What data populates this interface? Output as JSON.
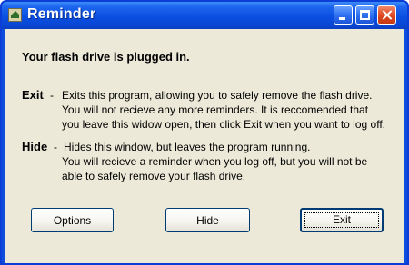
{
  "window": {
    "title": "Reminder",
    "icon": "app-icon"
  },
  "titlebar_buttons": {
    "minimize": "minimize-icon",
    "maximize": "maximize-icon",
    "close": "close-icon"
  },
  "content": {
    "headline": "Your flash drive is plugged in.",
    "exit_term": "Exit",
    "exit_sep": "-",
    "exit_lines": [
      "Exits this program, allowing you to safely remove the flash drive.",
      "You will not recieve any more reminders.  It is reccomended that",
      "you leave this widow open, then click Exit when you want to log off."
    ],
    "hide_term": "Hide",
    "hide_sep": "-",
    "hide_lines": [
      "Hides this window, but leaves the program running.",
      "You will recieve a reminder when you log off, but you will not be",
      "able to safely remove your flash drive."
    ]
  },
  "buttons": {
    "options": "Options",
    "hide": "Hide",
    "exit": "Exit"
  },
  "colors": {
    "titlebar": "#0a4fe0",
    "dialog_bg": "#ece9d8",
    "close_button": "#df4a22"
  }
}
